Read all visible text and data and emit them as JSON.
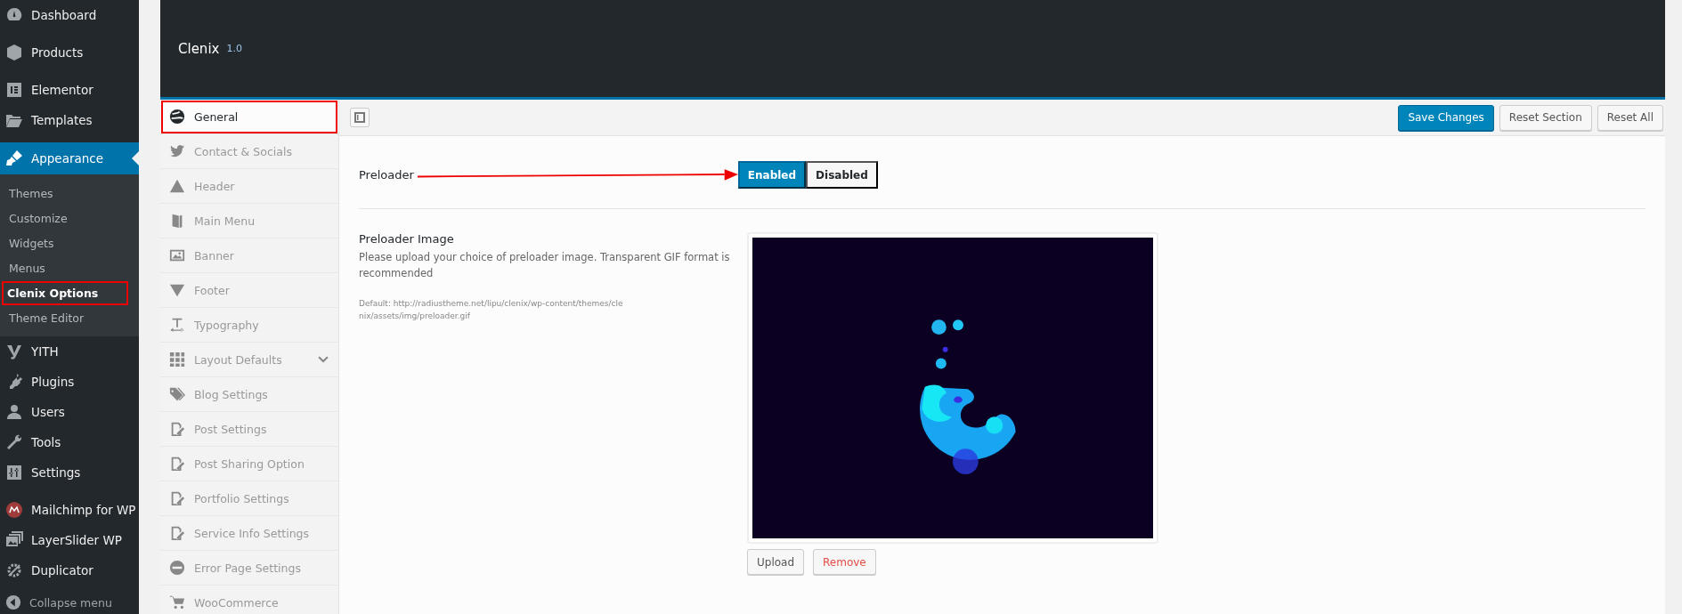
{
  "sidebar": {
    "groups": [
      [
        {
          "label": "Dashboard",
          "selected": false
        }
      ],
      [
        {
          "label": "Products",
          "selected": false
        }
      ],
      [
        {
          "label": "Elementor",
          "selected": false
        },
        {
          "label": "Templates",
          "selected": false
        }
      ],
      [
        {
          "label": "Appearance",
          "selected": true,
          "submenu": [
            {
              "label": "Themes",
              "selected": false,
              "annotated": false
            },
            {
              "label": "Customize",
              "selected": false,
              "annotated": false
            },
            {
              "label": "Widgets",
              "selected": false,
              "annotated": false
            },
            {
              "label": "Menus",
              "selected": false,
              "annotated": false
            },
            {
              "label": "Clenix Options",
              "selected": true,
              "annotated": true
            },
            {
              "label": "Theme Editor",
              "selected": false,
              "annotated": false
            }
          ]
        },
        {
          "label": "YITH",
          "selected": false
        },
        {
          "label": "Plugins",
          "selected": false
        },
        {
          "label": "Users",
          "selected": false
        },
        {
          "label": "Tools",
          "selected": false
        },
        {
          "label": "Settings",
          "selected": false
        }
      ],
      [
        {
          "label": "Mailchimp for WP",
          "selected": false
        },
        {
          "label": "LayerSlider WP",
          "selected": false
        },
        {
          "label": "Duplicator",
          "selected": false
        }
      ]
    ],
    "collapse_label": "Collapse menu"
  },
  "header": {
    "title": "Clenix",
    "version": "1.0"
  },
  "options_menu": {
    "items": [
      {
        "label": "General",
        "selected": true,
        "annotated": true,
        "expandable": false
      },
      {
        "label": "Contact & Socials",
        "selected": false,
        "annotated": false,
        "expandable": false
      },
      {
        "label": "Header",
        "selected": false,
        "annotated": false,
        "expandable": false
      },
      {
        "label": "Main Menu",
        "selected": false,
        "annotated": false,
        "expandable": false
      },
      {
        "label": "Banner",
        "selected": false,
        "annotated": false,
        "expandable": false
      },
      {
        "label": "Footer",
        "selected": false,
        "annotated": false,
        "expandable": false
      },
      {
        "label": "Typography",
        "selected": false,
        "annotated": false,
        "expandable": false
      },
      {
        "label": "Layout Defaults",
        "selected": false,
        "annotated": false,
        "expandable": true
      },
      {
        "label": "Blog Settings",
        "selected": false,
        "annotated": false,
        "expandable": false
      },
      {
        "label": "Post Settings",
        "selected": false,
        "annotated": false,
        "expandable": false
      },
      {
        "label": "Post Sharing Option",
        "selected": false,
        "annotated": false,
        "expandable": false
      },
      {
        "label": "Portfolio Settings",
        "selected": false,
        "annotated": false,
        "expandable": false
      },
      {
        "label": "Service Info Settings",
        "selected": false,
        "annotated": false,
        "expandable": false
      },
      {
        "label": "Error Page Settings",
        "selected": false,
        "annotated": false,
        "expandable": false
      },
      {
        "label": "WooCommerce",
        "selected": false,
        "annotated": false,
        "expandable": false
      }
    ]
  },
  "toolbar": {
    "buttons": [
      {
        "label": "Save Changes",
        "kind": "primary"
      },
      {
        "label": "Reset Section",
        "kind": "secondary"
      },
      {
        "label": "Reset All",
        "kind": "secondary"
      }
    ]
  },
  "preloader": {
    "label": "Preloader",
    "annotated": true,
    "options": [
      {
        "label": "Enabled",
        "selected": true
      },
      {
        "label": "Disabled",
        "selected": false
      }
    ]
  },
  "preloader_image": {
    "label": "Preloader Image",
    "description": "Please upload your choice of preloader image. Transparent GIF format is recommended",
    "default_note": "Default: http://radiustheme.net/lipu/clenix/wp-content/themes/clenix/assets/img/preloader.gif",
    "buttons": [
      {
        "label": "Upload",
        "kind": "default"
      },
      {
        "label": "Remove",
        "kind": "danger"
      }
    ]
  }
}
